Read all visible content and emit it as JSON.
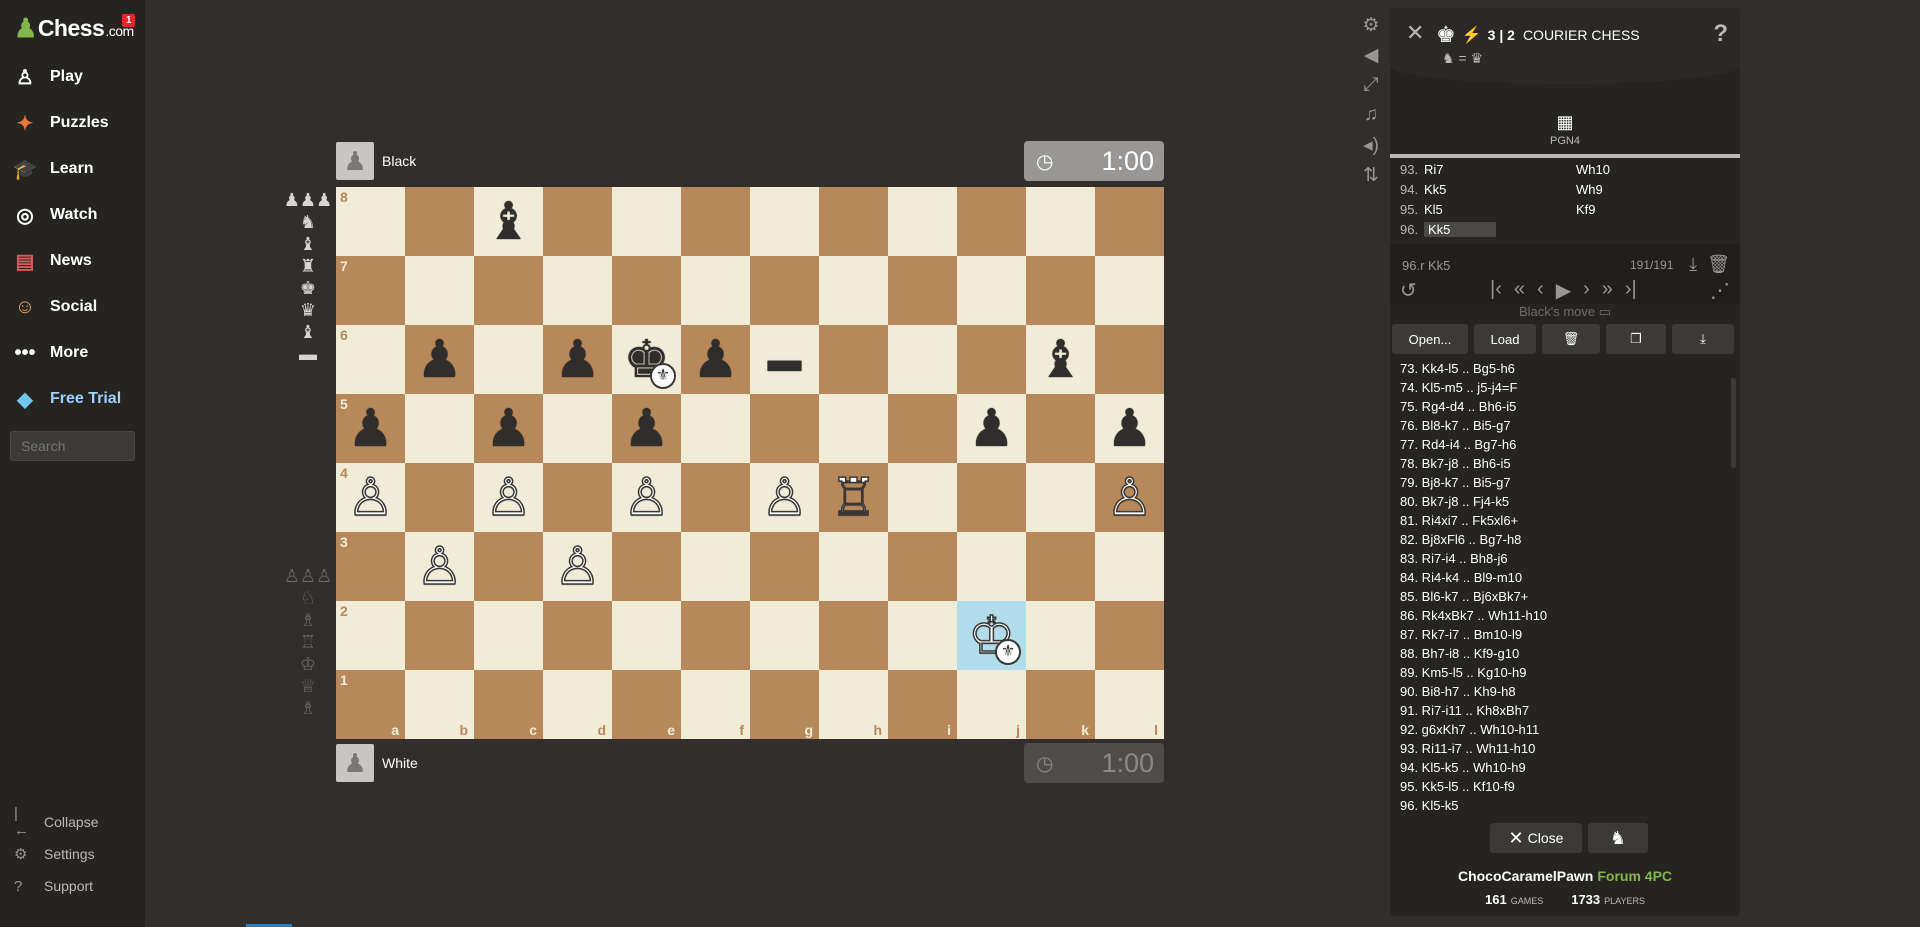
{
  "sidebar": {
    "logo_main": "Chess",
    "logo_suffix": ".com",
    "notification_count": "1",
    "nav": [
      {
        "label": "Play",
        "icon": "play-icon"
      },
      {
        "label": "Puzzles",
        "icon": "puzzles-icon"
      },
      {
        "label": "Learn",
        "icon": "learn-icon"
      },
      {
        "label": "Watch",
        "icon": "watch-icon"
      },
      {
        "label": "News",
        "icon": "news-icon"
      },
      {
        "label": "Social",
        "icon": "social-icon"
      },
      {
        "label": "More",
        "icon": "more-icon"
      },
      {
        "label": "Free Trial",
        "icon": "diamond-icon"
      }
    ],
    "search_placeholder": "Search",
    "footer": [
      {
        "label": "Collapse",
        "icon": "collapse-icon"
      },
      {
        "label": "Settings",
        "icon": "gear-icon"
      },
      {
        "label": "Support",
        "icon": "help-icon"
      }
    ]
  },
  "game": {
    "top_player": "Black",
    "bottom_player": "White",
    "top_clock": "1:00",
    "bottom_clock": "1:00",
    "files": [
      "a",
      "b",
      "c",
      "d",
      "e",
      "f",
      "g",
      "h",
      "i",
      "j",
      "k",
      "l"
    ],
    "ranks": [
      "8",
      "7",
      "6",
      "5",
      "4",
      "3",
      "2",
      "1"
    ]
  },
  "panel": {
    "time_control": "3 | 2",
    "variant_name": "COURIER CHESS",
    "promotion_info": "=",
    "pgn_label": "PGN4",
    "top_moves": [
      {
        "n": "93.",
        "w": "Ri7",
        "b": "Wh10"
      },
      {
        "n": "94.",
        "w": "Kk5",
        "b": "Wh9"
      },
      {
        "n": "95.",
        "w": "Kl5",
        "b": "Kf9"
      },
      {
        "n": "96.",
        "w": "Kk5",
        "b": ""
      }
    ],
    "current_move": "96.r  Kk5",
    "move_count": "191/191",
    "turn_status": "Black's move",
    "buttons": {
      "open": "Open...",
      "load": "Load"
    },
    "moves": [
      "73. Kk4-l5 .. Bg5-h6",
      "74. Kl5-m5 .. j5-j4=F",
      "75. Rg4-d4 .. Bh6-i5",
      "76. Bl8-k7 .. Bi5-g7",
      "77. Rd4-i4 .. Bg7-h6",
      "78. Bk7-j8 .. Bh6-i5",
      "79. Bj8-k7 .. Bi5-g7",
      "80. Bk7-j8 .. Fj4-k5",
      "81. Ri4xi7 .. Fk5xl6+",
      "82. Bj8xFl6 .. Bg7-h8",
      "83. Ri7-i4 .. Bh8-j6",
      "84. Ri4-k4 .. Bl9-m10",
      "85. Bl6-k7 .. Bj6xBk7+",
      "86. Rk4xBk7 .. Wh11-h10",
      "87. Rk7-i7 .. Bm10-l9",
      "88. Bh7-i8 .. Kf9-g10",
      "89. Km5-l5 .. Kg10-h9",
      "90. Bi8-h7 .. Kh9-h8",
      "91. Ri7-i11 .. Kh8xBh7",
      "92. g6xKh7 .. Wh10-h11",
      "93. Ri11-i7 .. Wh11-h10",
      "94. Kl5-k5 .. Wh10-h9",
      "95. Kk5-l5 .. Kf10-f9",
      "96. Kl5-k5"
    ],
    "close_label": "Close",
    "username": "ChocoCaramelPawn",
    "forum": "Forum 4PC",
    "games_count": "161",
    "games_label": "GAMES",
    "players_count": "1733",
    "players_label": "PLAYERS"
  }
}
